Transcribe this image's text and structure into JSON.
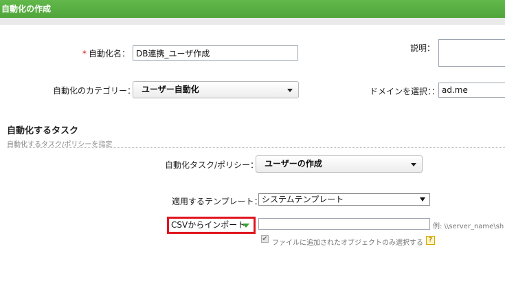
{
  "header": {
    "title": "自動化の作成"
  },
  "form": {
    "name_label": "自動化名：",
    "name_value": "DB連携_ユーザ作成",
    "description_label": "説明：",
    "category_label": "自動化のカテゴリー：",
    "category_value": "ユーザー自動化",
    "domain_label": "ドメインを選択：：",
    "domain_value": "ad.me"
  },
  "tasks_section": {
    "title": "自動化するタスク",
    "subtitle": "自動化するタスク/ポリシーを指定",
    "task_label": "自動化タスク/ポリシー：",
    "task_value": "ユーザーの作成",
    "template_label": "適用するテンプレート：",
    "template_value": "システムテンプレート",
    "import_source": "CSVからインポート",
    "path_hint": "例: \\\\server_name\\sh",
    "checkbox_label": "ファイルに追加されたオブジェクトのみ選択する",
    "help_glyph": "?"
  },
  "colors": {
    "header_green": "#4fa53a",
    "highlight_red": "#e0141e"
  }
}
